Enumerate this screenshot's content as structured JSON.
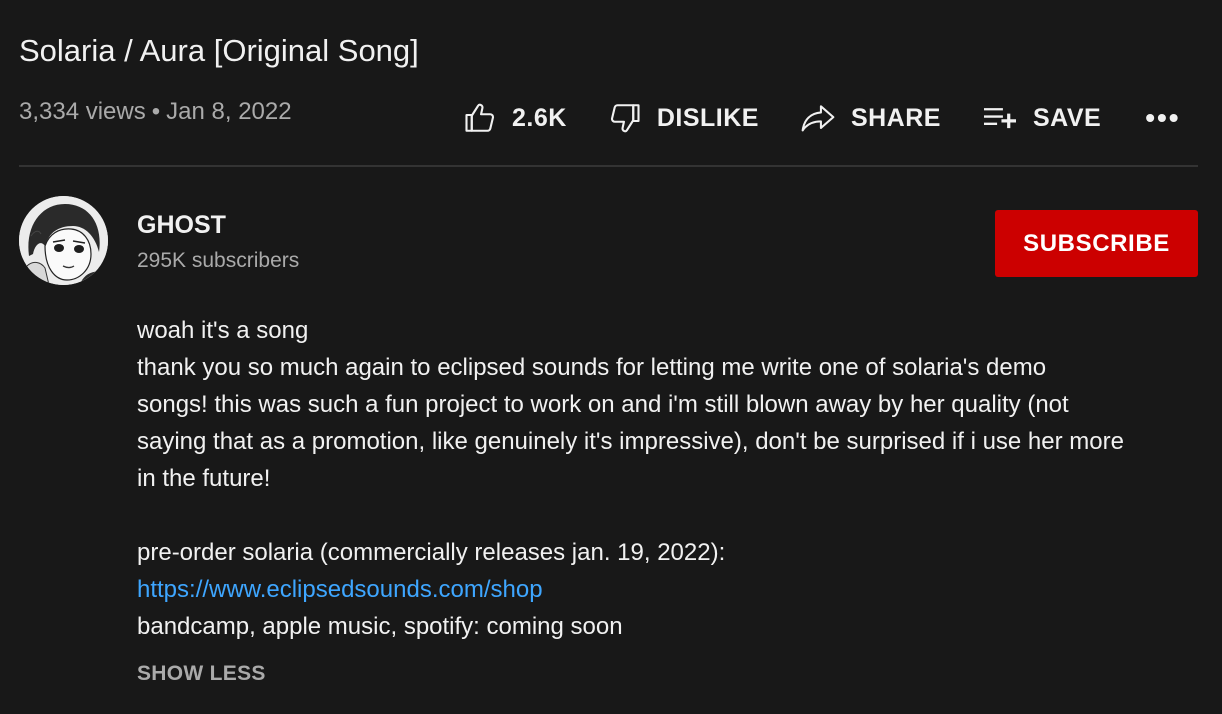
{
  "video": {
    "title": "Solaria / Aura [Original Song]",
    "views": "3,334 views",
    "separator": "•",
    "date": "Jan 8, 2022"
  },
  "actions": {
    "like": {
      "icon": "thumbs-up-icon",
      "label": "2.6K"
    },
    "dislike": {
      "icon": "thumbs-down-icon",
      "label": "DISLIKE"
    },
    "share": {
      "icon": "share-arrow-icon",
      "label": "SHARE"
    },
    "save": {
      "icon": "playlist-add-icon",
      "label": "SAVE"
    },
    "more": {
      "icon": "more-horizontal-icon",
      "label": "•••"
    }
  },
  "channel": {
    "name": "GHOST",
    "subscribers": "295K subscribers",
    "subscribe_label": "SUBSCRIBE"
  },
  "description": {
    "line1": "woah it's a song",
    "line2": "thank you so much again to eclipsed sounds for letting me write one of solaria's demo",
    "line3": "songs! this was such a fun project to work on and i'm still blown away by her quality (not",
    "line4": "saying that as a promotion, like genuinely it's impressive), don't be surprised if i use her more",
    "line5": "in the future!",
    "line6": "pre-order solaria (commercially releases jan. 19, 2022):",
    "link": "https://www.eclipsedsounds.com/shop",
    "line7": "bandcamp, apple music, spotify: coming soon"
  },
  "show_less_label": "SHOW LESS",
  "colors": {
    "background": "#181818",
    "text": "#f1f1f1",
    "muted": "#aaaaaa",
    "subscribe": "#cc0000",
    "link": "#3ea6ff"
  }
}
